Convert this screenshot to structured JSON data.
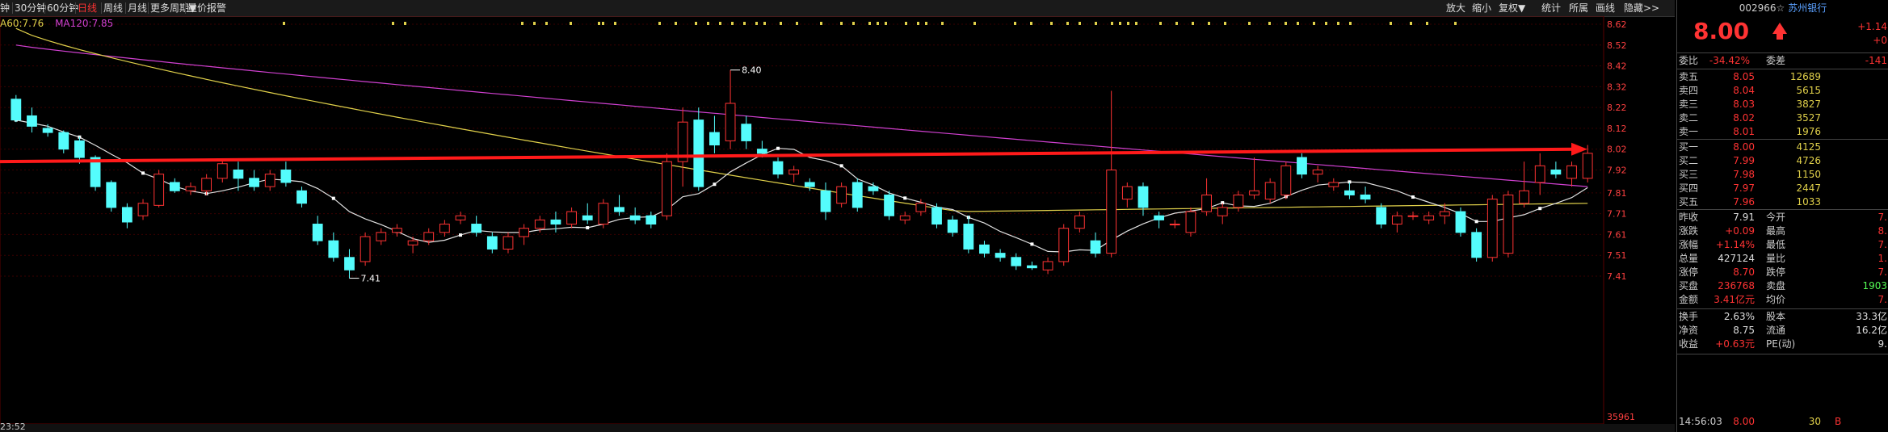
{
  "toolbar": {
    "items": [
      "钟",
      "30分钟",
      "60分钟",
      "日线",
      "周线",
      "月线",
      "更多周期▼",
      "量价报警"
    ],
    "active_index": 3,
    "right_items": [
      "放大",
      "缩小",
      "复权▼",
      "统计",
      "所属",
      "画线",
      "隐藏>>"
    ]
  },
  "ma_legend": {
    "ma60": "A60:7.76",
    "ma120": "MA120:7.85"
  },
  "status": {
    "time": "23:52"
  },
  "chart_data": {
    "type": "candlestick",
    "ylim": [
      7.41,
      8.62
    ],
    "ticks": [
      "8.62",
      "8.52",
      "8.42",
      "8.32",
      "8.22",
      "8.12",
      "8.02",
      "7.92",
      "7.81",
      "7.71",
      "7.61",
      "7.51",
      "7.41"
    ],
    "annotations": [
      {
        "label": "8.40",
        "value": 8.4
      },
      {
        "label": "7.41",
        "value": 7.41
      }
    ],
    "bottom_label": "35961",
    "series": [
      {
        "name": "MA60",
        "color": "#e0d04a"
      },
      {
        "name": "MA120",
        "color": "#d040d0"
      },
      {
        "name": "MA",
        "color": "#e0e0e0"
      }
    ],
    "candles": [
      [
        8.26,
        8.28,
        8.15,
        8.16
      ],
      [
        8.18,
        8.22,
        8.1,
        8.13
      ],
      [
        8.12,
        8.14,
        8.08,
        8.1
      ],
      [
        8.1,
        8.11,
        8.0,
        8.02
      ],
      [
        8.06,
        8.08,
        7.95,
        7.98
      ],
      [
        7.98,
        7.99,
        7.82,
        7.84
      ],
      [
        7.86,
        7.87,
        7.72,
        7.74
      ],
      [
        7.74,
        7.76,
        7.64,
        7.67
      ],
      [
        7.7,
        7.78,
        7.68,
        7.76
      ],
      [
        7.75,
        7.92,
        7.74,
        7.9
      ],
      [
        7.86,
        7.88,
        7.81,
        7.82
      ],
      [
        7.82,
        7.86,
        7.8,
        7.84
      ],
      [
        7.82,
        7.9,
        7.8,
        7.88
      ],
      [
        7.88,
        7.97,
        7.86,
        7.95
      ],
      [
        7.92,
        7.96,
        7.82,
        7.88
      ],
      [
        7.88,
        7.92,
        7.82,
        7.84
      ],
      [
        7.84,
        7.92,
        7.82,
        7.9
      ],
      [
        7.92,
        7.96,
        7.84,
        7.86
      ],
      [
        7.82,
        7.84,
        7.74,
        7.76
      ],
      [
        7.66,
        7.7,
        7.56,
        7.58
      ],
      [
        7.58,
        7.62,
        7.48,
        7.5
      ],
      [
        7.5,
        7.54,
        7.4,
        7.44
      ],
      [
        7.48,
        7.62,
        7.46,
        7.6
      ],
      [
        7.58,
        7.64,
        7.56,
        7.62
      ],
      [
        7.62,
        7.66,
        7.6,
        7.64
      ],
      [
        7.56,
        7.6,
        7.52,
        7.58
      ],
      [
        7.58,
        7.64,
        7.56,
        7.62
      ],
      [
        7.62,
        7.68,
        7.6,
        7.66
      ],
      [
        7.68,
        7.72,
        7.66,
        7.7
      ],
      [
        7.66,
        7.7,
        7.6,
        7.62
      ],
      [
        7.6,
        7.62,
        7.52,
        7.54
      ],
      [
        7.54,
        7.62,
        7.52,
        7.6
      ],
      [
        7.6,
        7.66,
        7.56,
        7.64
      ],
      [
        7.64,
        7.7,
        7.62,
        7.68
      ],
      [
        7.68,
        7.72,
        7.62,
        7.66
      ],
      [
        7.66,
        7.74,
        7.64,
        7.72
      ],
      [
        7.7,
        7.76,
        7.66,
        7.68
      ],
      [
        7.66,
        7.78,
        7.64,
        7.76
      ],
      [
        7.74,
        7.8,
        7.7,
        7.72
      ],
      [
        7.7,
        7.74,
        7.66,
        7.68
      ],
      [
        7.7,
        7.72,
        7.64,
        7.66
      ],
      [
        7.7,
        8.0,
        7.68,
        7.96
      ],
      [
        7.96,
        8.22,
        7.84,
        8.15
      ],
      [
        8.16,
        8.22,
        7.82,
        7.84
      ],
      [
        8.1,
        8.18,
        8.0,
        8.04
      ],
      [
        8.06,
        8.4,
        8.02,
        8.24
      ],
      [
        8.14,
        8.18,
        8.02,
        8.06
      ],
      [
        8.02,
        8.06,
        7.98,
        8.0
      ],
      [
        7.96,
        7.98,
        7.88,
        7.9
      ],
      [
        7.9,
        7.94,
        7.86,
        7.92
      ],
      [
        7.86,
        7.88,
        7.82,
        7.84
      ],
      [
        7.82,
        7.86,
        7.68,
        7.72
      ],
      [
        7.76,
        7.86,
        7.74,
        7.84
      ],
      [
        7.86,
        7.88,
        7.72,
        7.74
      ],
      [
        7.84,
        7.86,
        7.8,
        7.82
      ],
      [
        7.8,
        7.82,
        7.68,
        7.7
      ],
      [
        7.68,
        7.72,
        7.66,
        7.7
      ],
      [
        7.72,
        7.78,
        7.7,
        7.76
      ],
      [
        7.74,
        7.76,
        7.64,
        7.66
      ],
      [
        7.68,
        7.7,
        7.6,
        7.62
      ],
      [
        7.66,
        7.7,
        7.52,
        7.54
      ],
      [
        7.56,
        7.58,
        7.5,
        7.52
      ],
      [
        7.52,
        7.54,
        7.48,
        7.5
      ],
      [
        7.5,
        7.52,
        7.44,
        7.46
      ],
      [
        7.46,
        7.48,
        7.44,
        7.45
      ],
      [
        7.44,
        7.5,
        7.42,
        7.48
      ],
      [
        7.48,
        7.66,
        7.46,
        7.64
      ],
      [
        7.64,
        7.72,
        7.62,
        7.7
      ],
      [
        7.58,
        7.62,
        7.5,
        7.52
      ],
      [
        7.52,
        8.3,
        7.5,
        7.92
      ],
      [
        7.78,
        7.86,
        7.74,
        7.84
      ],
      [
        7.84,
        7.86,
        7.7,
        7.74
      ],
      [
        7.7,
        7.72,
        7.64,
        7.68
      ],
      [
        7.66,
        7.68,
        7.64,
        7.66
      ],
      [
        7.62,
        7.74,
        7.6,
        7.72
      ],
      [
        7.72,
        7.88,
        7.7,
        7.8
      ],
      [
        7.7,
        7.76,
        7.66,
        7.74
      ],
      [
        7.74,
        7.82,
        7.72,
        7.8
      ],
      [
        7.8,
        7.98,
        7.78,
        7.82
      ],
      [
        7.78,
        7.88,
        7.76,
        7.86
      ],
      [
        7.8,
        7.96,
        7.78,
        7.94
      ],
      [
        7.98,
        8.0,
        7.88,
        7.9
      ],
      [
        7.9,
        7.94,
        7.86,
        7.92
      ],
      [
        7.84,
        7.88,
        7.82,
        7.86
      ],
      [
        7.82,
        7.86,
        7.78,
        7.8
      ],
      [
        7.8,
        7.84,
        7.76,
        7.78
      ],
      [
        7.74,
        7.76,
        7.64,
        7.66
      ],
      [
        7.66,
        7.72,
        7.62,
        7.7
      ],
      [
        7.7,
        7.72,
        7.68,
        7.7
      ],
      [
        7.68,
        7.72,
        7.66,
        7.7
      ],
      [
        7.7,
        7.76,
        7.66,
        7.72
      ],
      [
        7.72,
        7.74,
        7.6,
        7.62
      ],
      [
        7.62,
        7.64,
        7.48,
        7.5
      ],
      [
        7.5,
        7.8,
        7.48,
        7.78
      ],
      [
        7.52,
        7.82,
        7.5,
        7.8
      ],
      [
        7.76,
        7.96,
        7.74,
        7.82
      ],
      [
        7.86,
        8.0,
        7.8,
        7.94
      ],
      [
        7.92,
        7.96,
        7.88,
        7.9
      ],
      [
        7.88,
        7.96,
        7.84,
        7.94
      ],
      [
        7.88,
        8.04,
        7.86,
        8.0
      ]
    ]
  },
  "right_panel": {
    "code": "002966☆",
    "name": "苏州银行",
    "price": "8.00",
    "price_change_top": "+1.14",
    "price_change_bot": "+0",
    "weibi_label": "委比",
    "weibi_value": "-34.42%",
    "weicha_label": "委差",
    "weicha_value": "-141",
    "sell": [
      {
        "label": "卖五",
        "price": "8.05",
        "vol": "12689"
      },
      {
        "label": "卖四",
        "price": "8.04",
        "vol": "5615"
      },
      {
        "label": "卖三",
        "price": "8.03",
        "vol": "3827"
      },
      {
        "label": "卖二",
        "price": "8.02",
        "vol": "3527"
      },
      {
        "label": "卖一",
        "price": "8.01",
        "vol": "1976"
      }
    ],
    "buy": [
      {
        "label": "买一",
        "price": "8.00",
        "vol": "4125"
      },
      {
        "label": "买二",
        "price": "7.99",
        "vol": "4726"
      },
      {
        "label": "买三",
        "price": "7.98",
        "vol": "1150"
      },
      {
        "label": "买四",
        "price": "7.97",
        "vol": "2447"
      },
      {
        "label": "买五",
        "price": "7.96",
        "vol": "1033"
      }
    ],
    "stats": [
      {
        "l1": "昨收",
        "v1": "7.91",
        "l2": "今开",
        "v2": "7."
      },
      {
        "l1": "涨跌",
        "v1": "+0.09",
        "l2": "最高",
        "v2": "8."
      },
      {
        "l1": "涨幅",
        "v1": "+1.14%",
        "l2": "最低",
        "v2": "7."
      },
      {
        "l1": "总量",
        "v1": "427124",
        "l2": "量比",
        "v2": "1."
      },
      {
        "l1": "涨停",
        "v1": "8.70",
        "l2": "跌停",
        "v2": "7."
      },
      {
        "l1": "买盘",
        "v1": "236768",
        "l2": "卖盘",
        "v2": "1903"
      },
      {
        "l1": "金额",
        "v1": "3.41亿元",
        "l2": "均价",
        "v2": "7."
      }
    ],
    "stats2": [
      {
        "l1": "换手",
        "v1": "2.63%",
        "l2": "股本",
        "v2": "33.3亿"
      },
      {
        "l1": "净资",
        "v1": "8.75",
        "l2": "流通",
        "v2": "16.2亿"
      },
      {
        "l1": "收益",
        "v1": "+0.63元",
        "l2": "PE(动)",
        "v2": "9."
      }
    ],
    "tick": {
      "time": "14:56:03",
      "price": "8.00",
      "vol": "30",
      "side": "B"
    }
  }
}
